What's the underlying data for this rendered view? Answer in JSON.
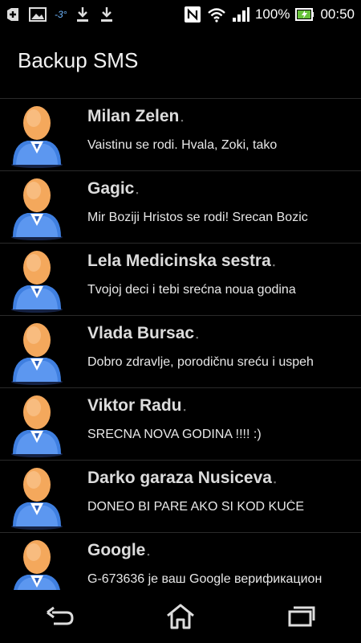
{
  "status_bar": {
    "temperature": "-3°",
    "battery": "100%",
    "time": "00:50",
    "icons": [
      "add-icon",
      "image-icon",
      "weather-icon",
      "download-icon",
      "download-icon",
      "nfc-icon",
      "wifi-icon",
      "signal-icon",
      "battery-icon"
    ]
  },
  "app": {
    "title": "Backup SMS"
  },
  "contacts": [
    {
      "name": "Milan Zelen",
      "message": "Vaistinu se rodi. Hvala, Zoki, tako"
    },
    {
      "name": "Gagic",
      "message": "Mir Boziji Hristos se rodi! Srecan Bozic"
    },
    {
      "name": "Lela Medicinska sestra",
      "message": "Tvojoj deci i tebi srećna noua godina"
    },
    {
      "name": "Vlada Bursac",
      "message": "Dobro zdravlje, porodičnu sreću i uspeh"
    },
    {
      "name": "Viktor Radu",
      "message": "SRECNA NOVA GODINA !!!! :)"
    },
    {
      "name": "Darko garaza Nusiceva",
      "message": "DONEO BI PARE AKO SI KOD KUĆE"
    },
    {
      "name": "Google",
      "message": "G-673636 је ваш Google верификациони"
    }
  ],
  "nav": {
    "icons": [
      "back-icon",
      "home-icon",
      "recent-apps-icon"
    ]
  },
  "colors": {
    "background": "#000000",
    "avatar_head": "#f4a85c",
    "avatar_body": "#3f7fe0",
    "temperature": "#6fb7ff"
  }
}
